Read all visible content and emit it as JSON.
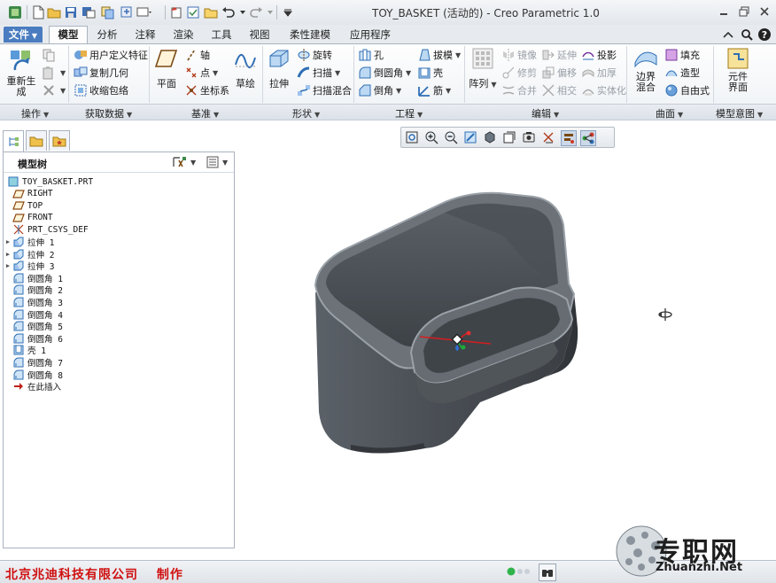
{
  "window": {
    "title": "TOY_BASKET (活动的) - Creo Parametric 1.0"
  },
  "tabs": [
    {
      "label": "文件",
      "id": "file"
    },
    {
      "label": "模型",
      "id": "model",
      "active": true
    },
    {
      "label": "分析",
      "id": "analysis"
    },
    {
      "label": "注释",
      "id": "annotate"
    },
    {
      "label": "渲染",
      "id": "render"
    },
    {
      "label": "工具",
      "id": "tools"
    },
    {
      "label": "视图",
      "id": "view"
    },
    {
      "label": "柔性建模",
      "id": "flexible"
    },
    {
      "label": "应用程序",
      "id": "apps"
    }
  ],
  "ribbon": {
    "regen_label": "重新生\n成",
    "user_defined_feature": "用户定义特征",
    "copy_geometry": "复制几何",
    "shrinkwrap": "收缩包络",
    "plane": "平面",
    "axis": "轴",
    "point": "点",
    "csys": "坐标系",
    "sketch": "草绘",
    "extrude": "拉伸",
    "revolve": "旋转",
    "sweep": "扫描",
    "swept_blend": "扫描混合",
    "hole": "孔",
    "round": "倒圆角",
    "chamfer": "倒角",
    "draft": "拔模",
    "shell": "壳",
    "rib": "筋",
    "pattern": "阵列",
    "mirror": "镜像",
    "trim": "修剪",
    "merge": "合并",
    "extend": "延伸",
    "offset": "偏移",
    "intersect": "相交",
    "project": "投影",
    "thicken": "加厚",
    "solidify": "实体化",
    "boundary_blend": "边界\n混合",
    "fill": "填充",
    "style": "造型",
    "freestyle": "自由式",
    "component_interface": "元件\n界面"
  },
  "groups": [
    {
      "label": "操作"
    },
    {
      "label": "获取数据"
    },
    {
      "label": "基准"
    },
    {
      "label": "形状"
    },
    {
      "label": "工程"
    },
    {
      "label": "编辑"
    },
    {
      "label": "曲面"
    },
    {
      "label": "模型意图"
    }
  ],
  "model_tree": {
    "title": "模型树",
    "items": [
      {
        "label": "TOY_BASKET.PRT",
        "icon": "part-icon",
        "expandable": false
      },
      {
        "label": "RIGHT",
        "icon": "datum-plane-icon",
        "expandable": false
      },
      {
        "label": "TOP",
        "icon": "datum-plane-icon",
        "expandable": false
      },
      {
        "label": "FRONT",
        "icon": "datum-plane-icon",
        "expandable": false
      },
      {
        "label": "PRT_CSYS_DEF",
        "icon": "csys-icon",
        "expandable": false
      },
      {
        "label": "拉伸 1",
        "icon": "extrude-icon",
        "expandable": true
      },
      {
        "label": "拉伸 2",
        "icon": "extrude-icon",
        "expandable": true
      },
      {
        "label": "拉伸 3",
        "icon": "extrude-icon",
        "expandable": true
      },
      {
        "label": "倒圆角 1",
        "icon": "round-icon",
        "expandable": false
      },
      {
        "label": "倒圆角 2",
        "icon": "round-icon",
        "expandable": false
      },
      {
        "label": "倒圆角 3",
        "icon": "round-icon",
        "expandable": false
      },
      {
        "label": "倒圆角 4",
        "icon": "round-icon",
        "expandable": false
      },
      {
        "label": "倒圆角 5",
        "icon": "round-icon",
        "expandable": false
      },
      {
        "label": "倒圆角 6",
        "icon": "round-icon",
        "expandable": false
      },
      {
        "label": "壳 1",
        "icon": "shell-icon",
        "expandable": false
      },
      {
        "label": "倒圆角 7",
        "icon": "round-icon",
        "expandable": false
      },
      {
        "label": "倒圆角 8",
        "icon": "round-icon",
        "expandable": false
      },
      {
        "label": "在此插入",
        "icon": "insert-here-arrow-icon",
        "expandable": false
      }
    ]
  },
  "status": {
    "company": "北京兆迪科技有限公司　 制作"
  },
  "watermark": {
    "cn": "专职网",
    "en": "Zhuanzhi.Net"
  },
  "colors": {
    "accent": "#4a7cc0",
    "model_body": "#4a4f55",
    "company_text": "#d01010"
  }
}
